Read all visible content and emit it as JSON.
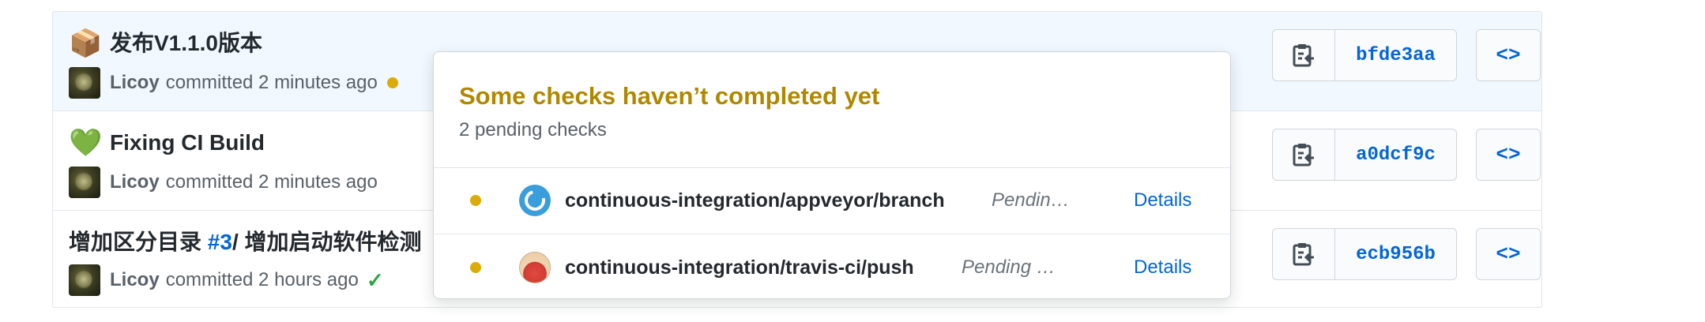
{
  "commits": [
    {
      "emoji": "📦",
      "title": "发布V1.1.0版本",
      "author": "Licoy",
      "meta": "committed 2 minutes ago",
      "status": "pending",
      "sha": "bfde3aa",
      "browse_label": "<>"
    },
    {
      "emoji": "💚",
      "title": "Fixing CI Build",
      "author": "Licoy",
      "meta": "committed 2 minutes ago",
      "sha": "a0dcf9c",
      "browse_label": "<>"
    },
    {
      "title_prefix": "增加区分目录 ",
      "issue_link": "#3",
      "title_suffix": "/ 增加启动软件检测",
      "author": "Licoy",
      "meta": "committed 2 hours ago",
      "status": "success",
      "status_glyph": "✓",
      "sha": "ecb956b",
      "browse_label": "<>"
    }
  ],
  "status_popover": {
    "title": "Some checks haven’t completed yet",
    "subtitle": "2 pending checks",
    "checks": [
      {
        "name": "continuous-integration/appveyor/branch",
        "status": "Pendin…",
        "details_label": "Details",
        "icon": "appveyor-icon"
      },
      {
        "name": "continuous-integration/travis-ci/push",
        "status": "Pending …",
        "details_label": "Details",
        "icon": "travis-ci-icon"
      }
    ]
  },
  "colors": {
    "pending": "#dbab09",
    "popover_title": "#b08800",
    "link": "#0366d6",
    "success": "#28a745",
    "highlight_row": "#f1f8ff"
  }
}
